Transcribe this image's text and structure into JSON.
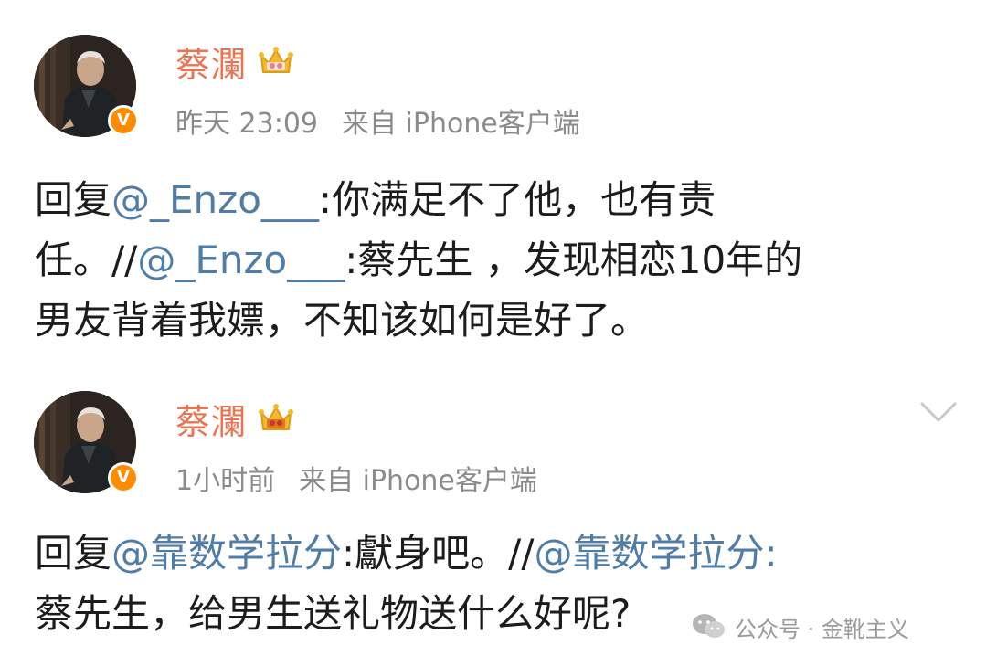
{
  "colors": {
    "username": "#eb7350",
    "mention": "#4f7da8",
    "meta": "#8b8b8b",
    "text": "#1c1c1c",
    "verified_badge": "#ff8b00"
  },
  "posts": [
    {
      "username": "蔡瀾",
      "time": "昨天 23:09",
      "source": "来自 iPhone客户端",
      "avatar_icon": "avatar-photo",
      "badge_icon": "verified-v-icon",
      "member_icon": "crown-icon",
      "verified_label": "V",
      "content": {
        "l1_a": "回复",
        "l1_mention": "@_Enzo___",
        "l1_b": ":你满足不了他，也有责",
        "l2_a": "任。//",
        "l2_mention": "@_Enzo___",
        "l2_b": ":蔡先生 ，发现相恋10年的",
        "l3": "男友背着我嫖，不知该如何是好了。"
      }
    },
    {
      "username": "蔡瀾",
      "time": "1小时前",
      "source": "来自 iPhone客户端",
      "avatar_icon": "avatar-photo",
      "badge_icon": "verified-v-icon",
      "member_icon": "crown-icon",
      "verified_label": "V",
      "menu_icon": "chevron-down-icon",
      "content": {
        "l1_a": "回复",
        "l1_mention": "@靠数学拉分",
        "l1_b": ":獻身吧。//",
        "l1_mention2": "@靠数学拉分",
        "l1_c": ":",
        "l2": "蔡先生，给男生送礼物送什么好呢?"
      }
    }
  ],
  "watermark": {
    "icon": "wechat-icon",
    "text": "公众号 · 金靴主义"
  }
}
